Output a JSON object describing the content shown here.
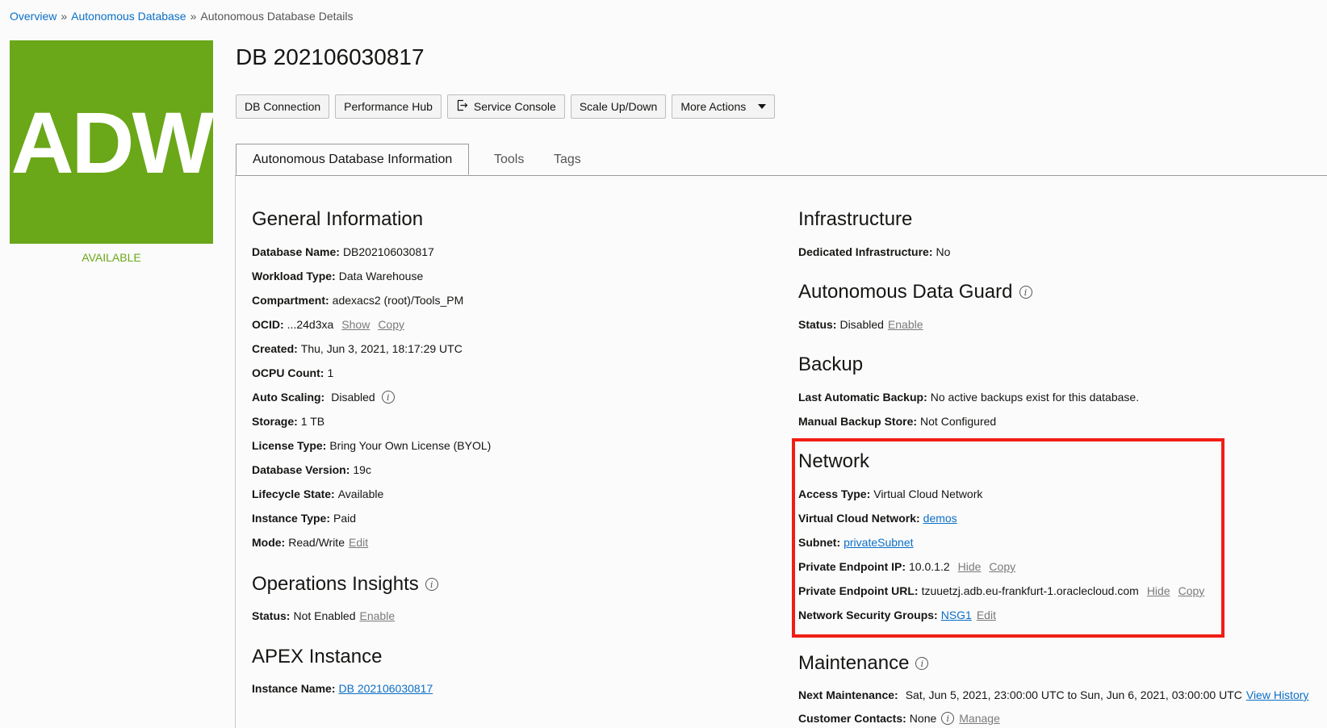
{
  "breadcrumb": {
    "overview": "Overview",
    "adb": "Autonomous Database",
    "sep": "»",
    "current": "Autonomous Database Details"
  },
  "logo": {
    "text": "ADW",
    "status": "AVAILABLE",
    "color": "#6aa719"
  },
  "title": "DB 202106030817",
  "buttons": {
    "db_connection": "DB Connection",
    "performance_hub": "Performance Hub",
    "service_console": "Service Console",
    "scale": "Scale Up/Down",
    "more_actions": "More Actions"
  },
  "tabs": {
    "info": "Autonomous Database Information",
    "tools": "Tools",
    "tags": "Tags"
  },
  "general": {
    "heading": "General Information",
    "database_name": {
      "label": "Database Name:",
      "value": "DB202106030817"
    },
    "workload_type": {
      "label": "Workload Type:",
      "value": "Data Warehouse"
    },
    "compartment": {
      "label": "Compartment:",
      "value": "adexacs2 (root)/Tools_PM"
    },
    "ocid": {
      "label": "OCID:",
      "value": "...24d3xa",
      "show": "Show",
      "copy": "Copy"
    },
    "created": {
      "label": "Created:",
      "value": "Thu, Jun 3, 2021, 18:17:29 UTC"
    },
    "ocpu": {
      "label": "OCPU Count:",
      "value": "1"
    },
    "auto_scaling": {
      "label": "Auto Scaling:",
      "value": "Disabled"
    },
    "storage": {
      "label": "Storage:",
      "value": "1 TB"
    },
    "license": {
      "label": "License Type:",
      "value": "Bring Your Own License (BYOL)"
    },
    "version": {
      "label": "Database Version:",
      "value": "19c"
    },
    "lifecycle": {
      "label": "Lifecycle State:",
      "value": "Available"
    },
    "instance_type": {
      "label": "Instance Type:",
      "value": "Paid"
    },
    "mode": {
      "label": "Mode:",
      "value": "Read/Write",
      "edit": "Edit"
    }
  },
  "ops_insights": {
    "heading": "Operations Insights",
    "label": "Status:",
    "value": "Not Enabled",
    "enable": "Enable"
  },
  "apex": {
    "heading": "APEX Instance",
    "label": "Instance Name:",
    "value": "DB 202106030817"
  },
  "infrastructure": {
    "heading": "Infrastructure",
    "label": "Dedicated Infrastructure:",
    "value": "No"
  },
  "data_guard": {
    "heading": "Autonomous Data Guard",
    "label": "Status:",
    "value": "Disabled",
    "enable": "Enable"
  },
  "backup": {
    "heading": "Backup",
    "last_label": "Last Automatic Backup:",
    "last_value": "No active backups exist for this database.",
    "store_label": "Manual Backup Store:",
    "store_value": "Not Configured"
  },
  "network": {
    "heading": "Network",
    "access_type": {
      "label": "Access Type:",
      "value": "Virtual Cloud Network"
    },
    "vcn": {
      "label": "Virtual Cloud Network:",
      "value": "demos"
    },
    "subnet": {
      "label": "Subnet:",
      "value": "privateSubnet"
    },
    "ip": {
      "label": "Private Endpoint IP:",
      "value": "10.0.1.2",
      "hide": "Hide",
      "copy": "Copy"
    },
    "url": {
      "label": "Private Endpoint URL:",
      "value": "tzuuetzj.adb.eu-frankfurt-1.oraclecloud.com",
      "hide": "Hide",
      "copy": "Copy"
    },
    "nsg": {
      "label": "Network Security Groups:",
      "value": "NSG1",
      "edit": "Edit"
    }
  },
  "maintenance": {
    "heading": "Maintenance",
    "next_label": "Next Maintenance:",
    "next_value": "Sat, Jun 5, 2021, 23:00:00 UTC to Sun, Jun 6, 2021, 03:00:00 UTC",
    "view_history": "View History",
    "contacts_label": "Customer Contacts:",
    "contacts_value": "None",
    "manage": "Manage"
  },
  "highlight_color": "#f01e14"
}
